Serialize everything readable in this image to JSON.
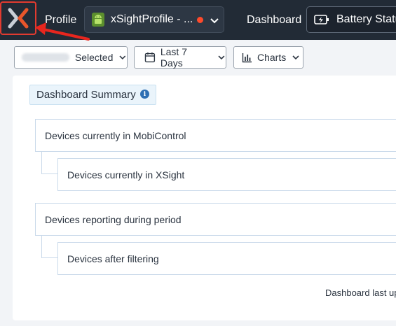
{
  "nav": {
    "profile_label": "Profile",
    "profile_select": "xSightProfile - ...",
    "dashboard_label": "Dashboard",
    "battery_select": "Battery Statu",
    "status_dot_color": "#ff4a2b",
    "accent": "#e23b30"
  },
  "filters": {
    "selected_label": "Selected",
    "date_range": "Last 7 Days",
    "charts": "Charts"
  },
  "summary": {
    "title": "Dashboard Summary",
    "info_glyph": "i",
    "rows": [
      "Devices currently in MobiControl",
      "Devices currently in XSight",
      "Devices reporting during period",
      "Devices after filtering"
    ],
    "last_updated": "Dashboard last up"
  },
  "icons": [
    "xsight-logo-icon",
    "android-icon",
    "chevron-down-icon",
    "battery-icon",
    "calendar-icon",
    "bar-chart-icon",
    "info-icon"
  ]
}
